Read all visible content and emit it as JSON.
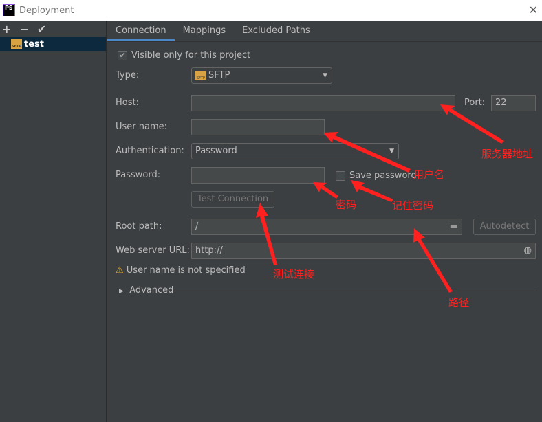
{
  "window": {
    "title": "Deployment",
    "logo": "PS"
  },
  "sidebar": {
    "toolbar": [
      "+",
      "−",
      "✔"
    ],
    "servers": [
      {
        "name": "test",
        "icon": "sftp-icon"
      }
    ]
  },
  "tabs": [
    {
      "label": "Connection",
      "active": true
    },
    {
      "label": "Mappings"
    },
    {
      "label": "Excluded Paths"
    }
  ],
  "form": {
    "visible_only": {
      "label": "Visible only for this project",
      "checked": true
    },
    "type": {
      "label": "Type:",
      "value": "SFTP"
    },
    "host": {
      "label": "Host:",
      "value": ""
    },
    "port": {
      "label": "Port:",
      "value": "22"
    },
    "username": {
      "label": "User name:",
      "value": ""
    },
    "auth": {
      "label": "Authentication:",
      "value": "Password"
    },
    "password": {
      "label": "Password:",
      "value": ""
    },
    "save_password": {
      "label": "Save password",
      "checked": false
    },
    "test_connection": "Test Connection",
    "root_path": {
      "label": "Root path:",
      "value": "/"
    },
    "autodetect": "Autodetect",
    "web_url": {
      "label": "Web server URL:",
      "value": "http://"
    },
    "warning": "User name is not specified",
    "advanced": "Advanced"
  },
  "annotations": {
    "host": "服务器地址",
    "username": "用户名",
    "password": "密码",
    "save_password": "记住密码",
    "test": "测试连接",
    "path": "路径",
    "color": "#ff2020"
  }
}
